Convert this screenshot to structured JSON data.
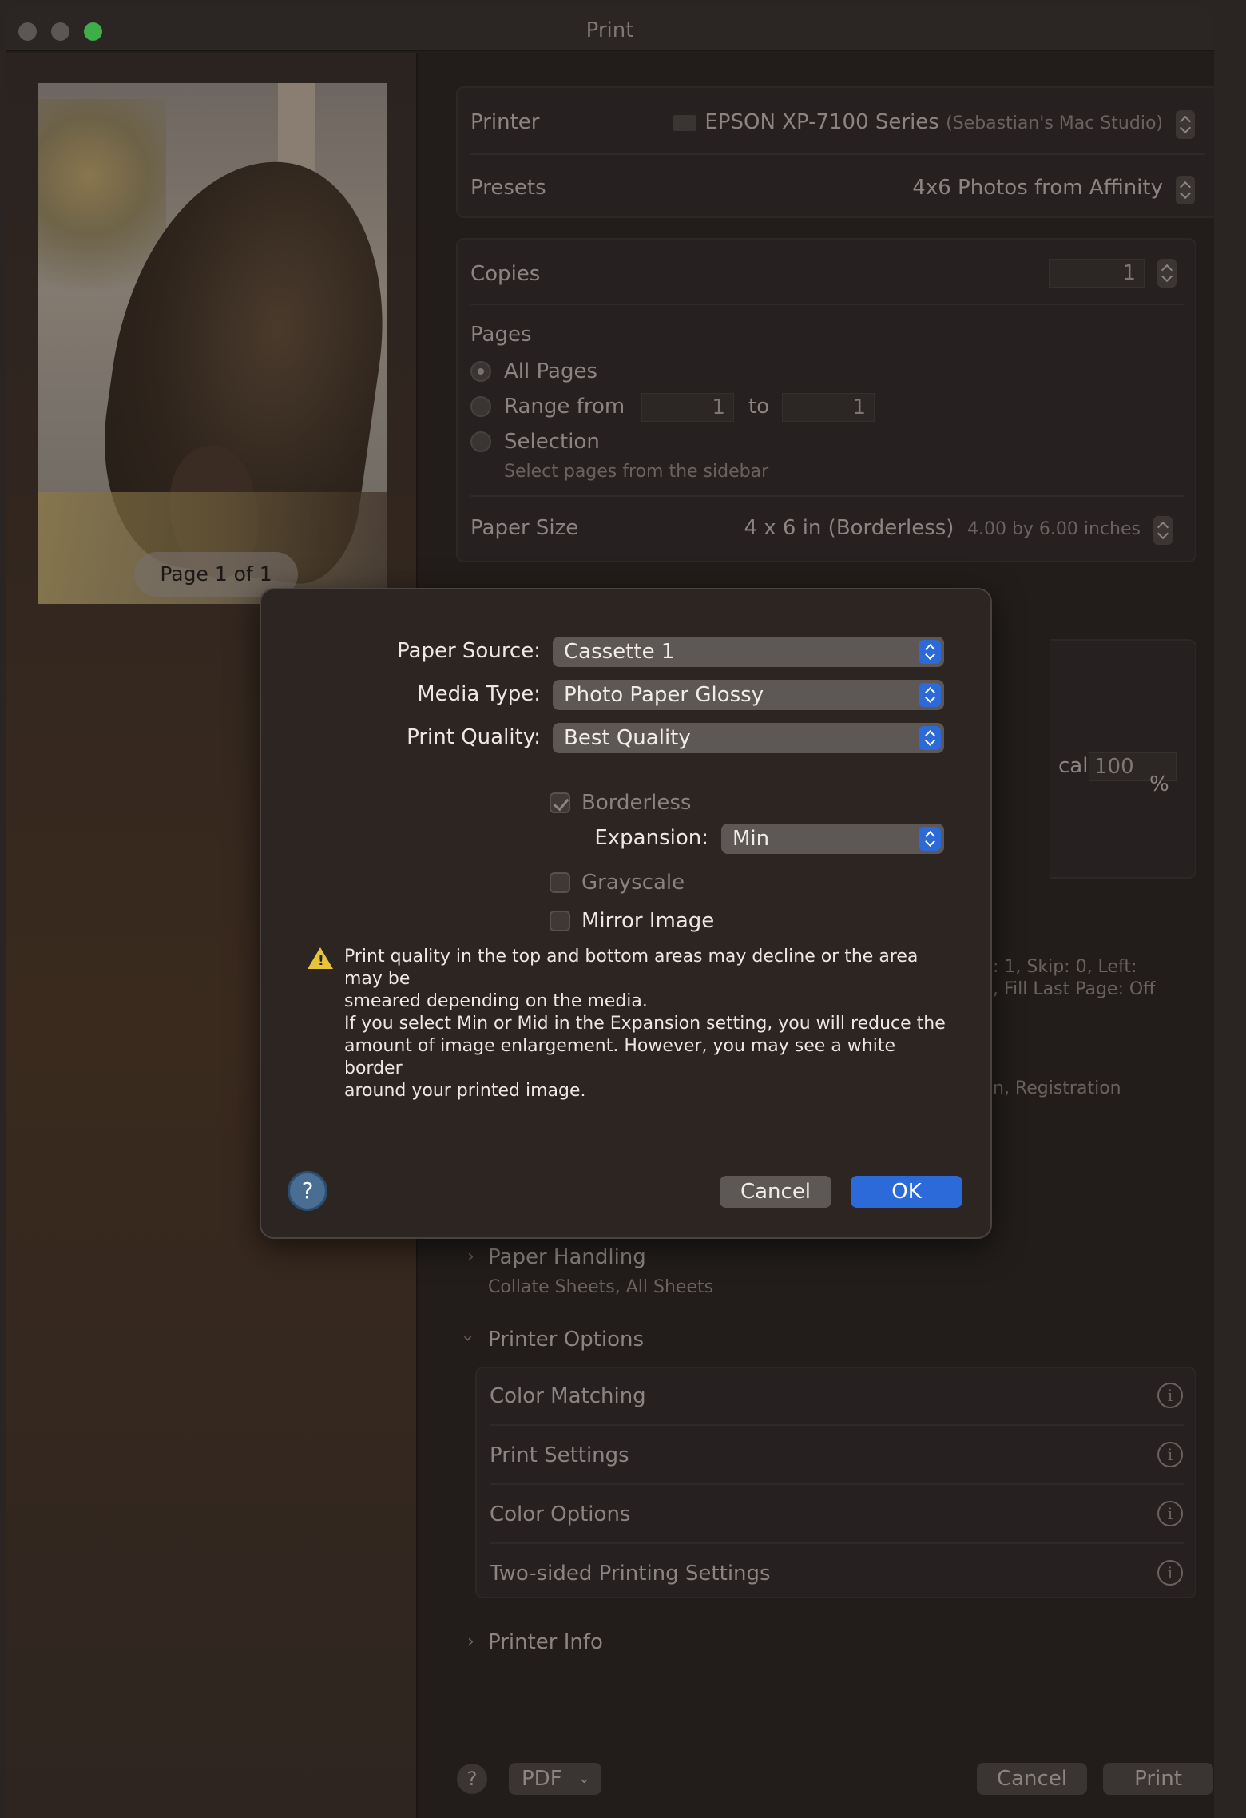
{
  "window": {
    "title": "Print"
  },
  "preview": {
    "page_indicator": "Page 1 of 1"
  },
  "printer": {
    "label": "Printer",
    "value": "EPSON XP-7100 Series",
    "host": "(Sebastian's Mac Studio)"
  },
  "presets": {
    "label": "Presets",
    "value": "4x6 Photos from Affinity"
  },
  "copies": {
    "label": "Copies",
    "value": "1"
  },
  "pages": {
    "label": "Pages",
    "all": "All Pages",
    "range": "Range from",
    "range_from": "1",
    "range_to_label": "to",
    "range_to": "1",
    "selection": "Selection",
    "selection_hint": "Select pages from the sidebar"
  },
  "paper_size": {
    "label": "Paper Size",
    "value": "4 x 6 in (Borderless)",
    "detail": "4.00 by 6.00 inches"
  },
  "scale": {
    "label_fragment": "cale:",
    "value": "100",
    "unit": "%"
  },
  "layout_fragment": {
    "line1": ": 1, Skip: 0, Left:",
    "line2": ", Fill Last Page: Off"
  },
  "registration_fragment": "n, Registration",
  "paper_handling": {
    "title": "Paper Handling",
    "subtitle": "Collate Sheets, All Sheets"
  },
  "printer_options": {
    "title": "Printer Options",
    "items": [
      "Color Matching",
      "Print Settings",
      "Color Options",
      "Two-sided Printing Settings"
    ]
  },
  "printer_info": {
    "title": "Printer Info"
  },
  "bottom": {
    "help": "?",
    "pdf": "PDF",
    "cancel": "Cancel",
    "print": "Print"
  },
  "sheet": {
    "paper_source": {
      "label": "Paper Source:",
      "value": "Cassette 1"
    },
    "media_type": {
      "label": "Media Type:",
      "value": "Photo Paper Glossy"
    },
    "print_quality": {
      "label": "Print Quality:",
      "value": "Best Quality"
    },
    "borderless": "Borderless",
    "expansion": {
      "label": "Expansion:",
      "value": "Min"
    },
    "grayscale": "Grayscale",
    "mirror": "Mirror Image",
    "warning": [
      "Print quality in the top and bottom areas may decline or the area may be",
      "smeared depending on the media.",
      "If you select Min or Mid in the Expansion setting, you will reduce the",
      "amount of image enlargement. However, you may see a white border",
      "around your printed image."
    ],
    "help": "?",
    "cancel": "Cancel",
    "ok": "OK"
  },
  "colors": {
    "accent": "#2b6ad8",
    "warning": "#e8c43a",
    "traffic_green": "#3fae48"
  }
}
